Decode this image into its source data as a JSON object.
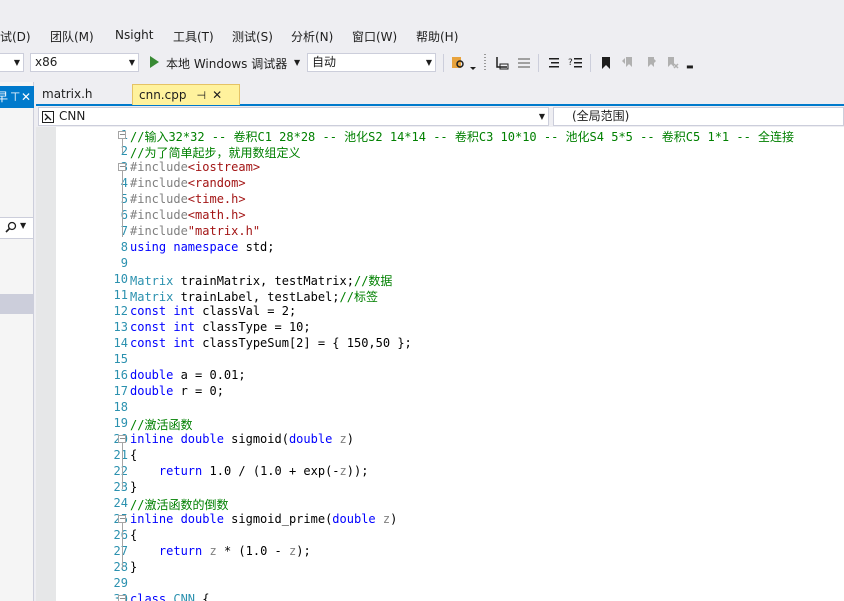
{
  "menu": {
    "items": [
      "试(D)",
      "团队(M)",
      "Nsight",
      "工具(T)",
      "测试(S)",
      "分析(N)",
      "窗口(W)",
      "帮助(H)"
    ]
  },
  "toolbar": {
    "platform_value": "x86",
    "run_label": "本地 Windows 调试器",
    "config_value": "自动"
  },
  "left_panel": {
    "header_text": "早"
  },
  "tabs": [
    {
      "label": "matrix.h",
      "active": false
    },
    {
      "label": "cnn.cpp",
      "active": true
    }
  ],
  "navbar": {
    "project": "CNN",
    "scope": "(全局范围)"
  },
  "code_lines": [
    {
      "n": "1",
      "html": "<span class=\"c\">//输入32*32 -- 卷积C1 28*28 -- 池化S2 14*14 -- 卷积C3 10*10 -- 池化S4 5*5 -- 卷积C5 1*1 -- 全连接</span>"
    },
    {
      "n": "2",
      "html": "<span class=\"c\">//为了简单起步，就用数组定义</span>"
    },
    {
      "n": "3",
      "html": "<span class=\"p\">#include</span><span class=\"s\">&lt;iostream&gt;</span>"
    },
    {
      "n": "4",
      "html": "<span class=\"p\">#include</span><span class=\"s\">&lt;random&gt;</span>"
    },
    {
      "n": "5",
      "html": "<span class=\"p\">#include</span><span class=\"s\">&lt;time.h&gt;</span>"
    },
    {
      "n": "6",
      "html": "<span class=\"p\">#include</span><span class=\"s\">&lt;math.h&gt;</span>"
    },
    {
      "n": "7",
      "html": "<span class=\"p\">#include</span><span class=\"s\">\"matrix.h\"</span>"
    },
    {
      "n": "8",
      "html": "<span class=\"k\">using namespace</span> std;"
    },
    {
      "n": "9",
      "html": ""
    },
    {
      "n": "10",
      "html": "<span class=\"t\">Matrix</span> trainMatrix, testMatrix;<span class=\"c\">//数据</span>"
    },
    {
      "n": "11",
      "html": "<span class=\"t\">Matrix</span> trainLabel, testLabel;<span class=\"c\">//标签</span>"
    },
    {
      "n": "12",
      "html": "<span class=\"k\">const int</span> classVal = 2;"
    },
    {
      "n": "13",
      "html": "<span class=\"k\">const int</span> classType = 10;"
    },
    {
      "n": "14",
      "html": "<span class=\"k\">const int</span> classTypeSum[2] = { 150,50 };"
    },
    {
      "n": "15",
      "html": ""
    },
    {
      "n": "16",
      "html": "<span class=\"k\">double</span> a = 0.01;"
    },
    {
      "n": "17",
      "html": "<span class=\"k\">double</span> r = 0;"
    },
    {
      "n": "18",
      "html": ""
    },
    {
      "n": "19",
      "html": "<span class=\"c\">//激活函数</span>"
    },
    {
      "n": "20",
      "html": "<span class=\"k\">inline double</span> sigmoid(<span class=\"k\">double</span> <span class=\"p\">z</span>)"
    },
    {
      "n": "21",
      "html": "{"
    },
    {
      "n": "22",
      "html": "    <span class=\"k\">return</span> 1.0 / (1.0 + exp(-<span class=\"p\">z</span>));"
    },
    {
      "n": "23",
      "html": "}"
    },
    {
      "n": "24",
      "html": "<span class=\"c\">//激活函数的倒数</span>"
    },
    {
      "n": "25",
      "html": "<span class=\"k\">inline double</span> sigmoid_prime(<span class=\"k\">double</span> <span class=\"p\">z</span>)"
    },
    {
      "n": "26",
      "html": "{"
    },
    {
      "n": "27",
      "html": "    <span class=\"k\">return</span> <span class=\"p\">z</span> * (1.0 - <span class=\"p\">z</span>);"
    },
    {
      "n": "28",
      "html": "}"
    },
    {
      "n": "29",
      "html": ""
    },
    {
      "n": "30",
      "html": "<span class=\"k\">class</span> <span class=\"t\">CNN</span> {"
    }
  ]
}
